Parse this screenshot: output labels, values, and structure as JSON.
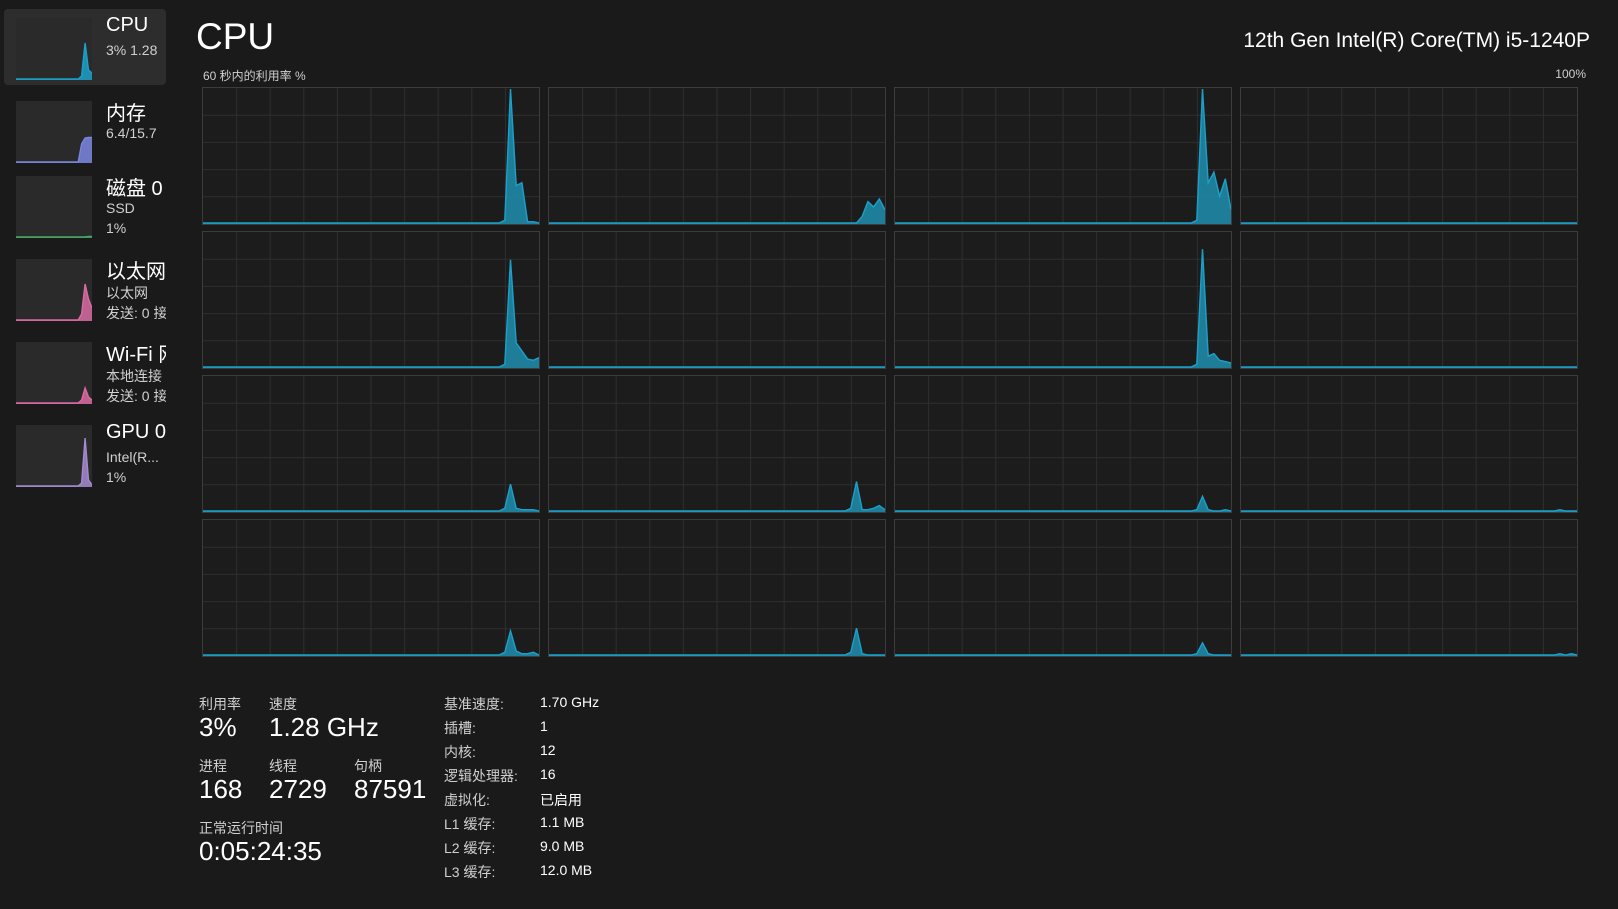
{
  "sidebar": {
    "items": [
      {
        "name": "CPU",
        "sub1": "3%  1.28",
        "sub2": "",
        "color": "#1ba1c9",
        "spark": [
          0,
          0,
          0,
          0,
          0,
          0,
          0,
          0,
          0,
          0,
          0,
          0,
          0,
          0,
          0,
          0,
          0,
          0,
          0,
          0.05,
          0.6,
          0.15,
          0.1
        ]
      },
      {
        "name": "内存",
        "sub1": "6.4/15.7",
        "sub2": "",
        "color": "#7a86e0",
        "spark": [
          0,
          0,
          0,
          0,
          0,
          0,
          0,
          0,
          0,
          0,
          0,
          0,
          0,
          0,
          0,
          0,
          0,
          0,
          0,
          0.3,
          0.4,
          0.41,
          0.41
        ]
      },
      {
        "name": "磁盘 0",
        "sub1": "SSD",
        "sub2": "1%",
        "color": "#4aa564",
        "spark": [
          0,
          0,
          0,
          0,
          0,
          0,
          0,
          0,
          0,
          0,
          0,
          0,
          0,
          0,
          0,
          0,
          0,
          0,
          0,
          0,
          0,
          0.01,
          0.01
        ]
      },
      {
        "name": "以太网",
        "sub1": "以太网",
        "sub2": "发送: 0 接",
        "color": "#d86ba3",
        "spark": [
          0,
          0,
          0,
          0,
          0,
          0,
          0,
          0,
          0,
          0,
          0,
          0,
          0,
          0,
          0,
          0,
          0,
          0,
          0,
          0.1,
          0.6,
          0.35,
          0.2
        ]
      },
      {
        "name": "Wi-Fi 网",
        "sub1": "本地连接",
        "sub2": "发送: 0 接",
        "color": "#d86ba3",
        "spark": [
          0,
          0,
          0,
          0,
          0,
          0,
          0,
          0,
          0,
          0,
          0,
          0,
          0,
          0,
          0,
          0,
          0,
          0,
          0,
          0.05,
          0.25,
          0.1,
          0.05
        ]
      },
      {
        "name": "GPU 0",
        "sub1": "Intel(R...",
        "sub2": "1%",
        "color": "#a48ad0",
        "spark": [
          0,
          0,
          0,
          0,
          0,
          0,
          0,
          0,
          0,
          0,
          0,
          0,
          0,
          0,
          0,
          0,
          0,
          0,
          0,
          0.05,
          0.8,
          0.1,
          0.02
        ]
      }
    ]
  },
  "header": {
    "title": "CPU",
    "model": "12th Gen Intel(R) Core(TM) i5-1240P",
    "graph_label": "60 秒内的利用率 %",
    "graph_max": "100%"
  },
  "colors": {
    "line": "#1ba1c9",
    "fill": "#1f8fb0",
    "grid": "#2f2f2f"
  },
  "cores": [
    {
      "values": [
        0,
        0,
        0,
        0,
        0,
        0,
        0,
        0,
        0,
        0,
        0,
        0,
        0,
        0,
        0,
        0,
        0,
        0,
        0,
        0,
        0,
        0,
        0,
        0,
        0,
        0,
        0,
        0,
        0,
        0,
        0,
        0,
        0,
        0,
        0,
        0,
        0,
        0,
        0,
        0,
        0,
        0,
        0,
        0,
        0,
        0,
        0,
        0,
        0,
        0,
        0,
        0,
        0,
        0.02,
        1.0,
        0.28,
        0.3,
        0.01,
        0.01,
        0
      ]
    },
    {
      "values": [
        0,
        0,
        0,
        0,
        0,
        0,
        0,
        0,
        0,
        0,
        0,
        0,
        0,
        0,
        0,
        0,
        0,
        0,
        0,
        0,
        0,
        0,
        0,
        0,
        0,
        0,
        0,
        0,
        0,
        0,
        0,
        0,
        0,
        0,
        0,
        0,
        0,
        0,
        0,
        0,
        0,
        0,
        0,
        0,
        0,
        0,
        0,
        0,
        0,
        0,
        0,
        0,
        0,
        0,
        0,
        0.05,
        0.16,
        0.12,
        0.18,
        0.1
      ]
    },
    {
      "values": [
        0,
        0,
        0,
        0,
        0,
        0,
        0,
        0,
        0,
        0,
        0,
        0,
        0,
        0,
        0,
        0,
        0,
        0,
        0,
        0,
        0,
        0,
        0,
        0,
        0,
        0,
        0,
        0,
        0,
        0,
        0,
        0,
        0,
        0,
        0,
        0,
        0,
        0,
        0,
        0,
        0,
        0,
        0,
        0,
        0,
        0,
        0,
        0,
        0,
        0,
        0,
        0,
        0,
        0.02,
        1.0,
        0.3,
        0.38,
        0.2,
        0.33,
        0.1
      ]
    },
    {
      "values": [
        0,
        0,
        0,
        0,
        0,
        0,
        0,
        0,
        0,
        0,
        0,
        0,
        0,
        0,
        0,
        0,
        0,
        0,
        0,
        0,
        0,
        0,
        0,
        0,
        0,
        0,
        0,
        0,
        0,
        0,
        0,
        0,
        0,
        0,
        0,
        0,
        0,
        0,
        0,
        0,
        0,
        0,
        0,
        0,
        0,
        0,
        0,
        0,
        0,
        0,
        0,
        0,
        0,
        0,
        0,
        0,
        0,
        0,
        0,
        0
      ]
    },
    {
      "values": [
        0,
        0,
        0,
        0,
        0,
        0,
        0,
        0,
        0,
        0,
        0,
        0,
        0,
        0,
        0,
        0,
        0,
        0,
        0,
        0,
        0,
        0,
        0,
        0,
        0,
        0,
        0,
        0,
        0,
        0,
        0,
        0,
        0,
        0,
        0,
        0,
        0,
        0,
        0,
        0,
        0,
        0,
        0,
        0,
        0,
        0,
        0,
        0,
        0,
        0,
        0,
        0,
        0,
        0.02,
        0.8,
        0.18,
        0.12,
        0.06,
        0.05,
        0.07
      ]
    },
    {
      "values": [
        0,
        0,
        0,
        0,
        0,
        0,
        0,
        0,
        0,
        0,
        0,
        0,
        0,
        0,
        0,
        0,
        0,
        0,
        0,
        0,
        0,
        0,
        0,
        0,
        0,
        0,
        0,
        0,
        0,
        0,
        0,
        0,
        0,
        0,
        0,
        0,
        0,
        0,
        0,
        0,
        0,
        0,
        0,
        0,
        0,
        0,
        0,
        0,
        0,
        0,
        0,
        0,
        0,
        0,
        0,
        0,
        0,
        0,
        0,
        0
      ]
    },
    {
      "values": [
        0,
        0,
        0,
        0,
        0,
        0,
        0,
        0,
        0,
        0,
        0,
        0,
        0,
        0,
        0,
        0,
        0,
        0,
        0,
        0,
        0,
        0,
        0,
        0,
        0,
        0,
        0,
        0,
        0,
        0,
        0,
        0,
        0,
        0,
        0,
        0,
        0,
        0,
        0,
        0,
        0,
        0,
        0,
        0,
        0,
        0,
        0,
        0,
        0,
        0,
        0,
        0,
        0,
        0.02,
        0.88,
        0.08,
        0.1,
        0.05,
        0.04,
        0.03
      ]
    },
    {
      "values": [
        0,
        0,
        0,
        0,
        0,
        0,
        0,
        0,
        0,
        0,
        0,
        0,
        0,
        0,
        0,
        0,
        0,
        0,
        0,
        0,
        0,
        0,
        0,
        0,
        0,
        0,
        0,
        0,
        0,
        0,
        0,
        0,
        0,
        0,
        0,
        0,
        0,
        0,
        0,
        0,
        0,
        0,
        0,
        0,
        0,
        0,
        0,
        0,
        0,
        0,
        0,
        0,
        0,
        0,
        0,
        0,
        0,
        0,
        0,
        0
      ]
    },
    {
      "values": [
        0,
        0,
        0,
        0,
        0,
        0,
        0,
        0,
        0,
        0,
        0,
        0,
        0,
        0,
        0,
        0,
        0,
        0,
        0,
        0,
        0,
        0,
        0,
        0,
        0,
        0,
        0,
        0,
        0,
        0,
        0,
        0,
        0,
        0,
        0,
        0,
        0,
        0,
        0,
        0,
        0,
        0,
        0,
        0,
        0,
        0,
        0,
        0,
        0,
        0,
        0,
        0,
        0,
        0.02,
        0.2,
        0.02,
        0.01,
        0.01,
        0.01,
        0
      ]
    },
    {
      "values": [
        0,
        0,
        0,
        0,
        0,
        0,
        0,
        0,
        0,
        0,
        0,
        0,
        0,
        0,
        0,
        0,
        0,
        0,
        0,
        0,
        0,
        0,
        0,
        0,
        0,
        0,
        0,
        0,
        0,
        0,
        0,
        0,
        0,
        0,
        0,
        0,
        0,
        0,
        0,
        0,
        0,
        0,
        0,
        0,
        0,
        0,
        0,
        0,
        0,
        0,
        0,
        0,
        0,
        0.02,
        0.22,
        0.01,
        0.01,
        0.02,
        0.04,
        0.01
      ]
    },
    {
      "values": [
        0,
        0,
        0,
        0,
        0,
        0,
        0,
        0,
        0,
        0,
        0,
        0,
        0,
        0,
        0,
        0,
        0,
        0,
        0,
        0,
        0,
        0,
        0,
        0,
        0,
        0,
        0,
        0,
        0,
        0,
        0,
        0,
        0,
        0,
        0,
        0,
        0,
        0,
        0,
        0,
        0,
        0,
        0,
        0,
        0,
        0,
        0,
        0,
        0,
        0,
        0,
        0,
        0,
        0.01,
        0.11,
        0.01,
        0,
        0,
        0.01,
        0
      ]
    },
    {
      "values": [
        0,
        0,
        0,
        0,
        0,
        0,
        0,
        0,
        0,
        0,
        0,
        0,
        0,
        0,
        0,
        0,
        0,
        0,
        0,
        0,
        0,
        0,
        0,
        0,
        0,
        0,
        0,
        0,
        0,
        0,
        0,
        0,
        0,
        0,
        0,
        0,
        0,
        0,
        0,
        0,
        0,
        0,
        0,
        0,
        0,
        0,
        0,
        0,
        0,
        0,
        0,
        0,
        0,
        0,
        0,
        0,
        0.01,
        0,
        0,
        0
      ]
    },
    {
      "values": [
        0,
        0,
        0,
        0,
        0,
        0,
        0,
        0,
        0,
        0,
        0,
        0,
        0,
        0,
        0,
        0,
        0,
        0,
        0,
        0,
        0,
        0,
        0,
        0,
        0,
        0,
        0,
        0,
        0,
        0,
        0,
        0,
        0,
        0,
        0,
        0,
        0,
        0,
        0,
        0,
        0,
        0,
        0,
        0,
        0,
        0,
        0,
        0,
        0,
        0,
        0,
        0,
        0,
        0.02,
        0.18,
        0.03,
        0.01,
        0.01,
        0.02,
        0
      ]
    },
    {
      "values": [
        0,
        0,
        0,
        0,
        0,
        0,
        0,
        0,
        0,
        0,
        0,
        0,
        0,
        0,
        0,
        0,
        0,
        0,
        0,
        0,
        0,
        0,
        0,
        0,
        0,
        0,
        0,
        0,
        0,
        0,
        0,
        0,
        0,
        0,
        0,
        0,
        0,
        0,
        0,
        0,
        0,
        0,
        0,
        0,
        0,
        0,
        0,
        0,
        0,
        0,
        0,
        0,
        0,
        0.02,
        0.2,
        0.01,
        0,
        0,
        0,
        0
      ]
    },
    {
      "values": [
        0,
        0,
        0,
        0,
        0,
        0,
        0,
        0,
        0,
        0,
        0,
        0,
        0,
        0,
        0,
        0,
        0,
        0,
        0,
        0,
        0,
        0,
        0,
        0,
        0,
        0,
        0,
        0,
        0,
        0,
        0,
        0,
        0,
        0,
        0,
        0,
        0,
        0,
        0,
        0,
        0,
        0,
        0,
        0,
        0,
        0,
        0,
        0,
        0,
        0,
        0,
        0,
        0,
        0.01,
        0.09,
        0.01,
        0,
        0,
        0,
        0
      ]
    },
    {
      "values": [
        0,
        0,
        0,
        0,
        0,
        0,
        0,
        0,
        0,
        0,
        0,
        0,
        0,
        0,
        0,
        0,
        0,
        0,
        0,
        0,
        0,
        0,
        0,
        0,
        0,
        0,
        0,
        0,
        0,
        0,
        0,
        0,
        0,
        0,
        0,
        0,
        0,
        0,
        0,
        0,
        0,
        0,
        0,
        0,
        0,
        0,
        0,
        0,
        0,
        0,
        0,
        0,
        0,
        0,
        0,
        0,
        0.01,
        0,
        0.01,
        0
      ]
    }
  ],
  "stats": {
    "utilization_label": "利用率",
    "utilization_value": "3%",
    "speed_label": "速度",
    "speed_value": "1.28 GHz",
    "processes_label": "进程",
    "processes_value": "168",
    "threads_label": "线程",
    "threads_value": "2729",
    "handles_label": "句柄",
    "handles_value": "87591",
    "uptime_label": "正常运行时间",
    "uptime_value": "0:05:24:35"
  },
  "specs": [
    {
      "label": "基准速度:",
      "value": "1.70 GHz"
    },
    {
      "label": "插槽:",
      "value": "1"
    },
    {
      "label": "内核:",
      "value": "12"
    },
    {
      "label": "逻辑处理器:",
      "value": "16"
    },
    {
      "label": "虚拟化:",
      "value": "已启用"
    },
    {
      "label": "L1 缓存:",
      "value": "1.1 MB"
    },
    {
      "label": "L2 缓存:",
      "value": "9.0 MB"
    },
    {
      "label": "L3 缓存:",
      "value": "12.0 MB"
    }
  ]
}
